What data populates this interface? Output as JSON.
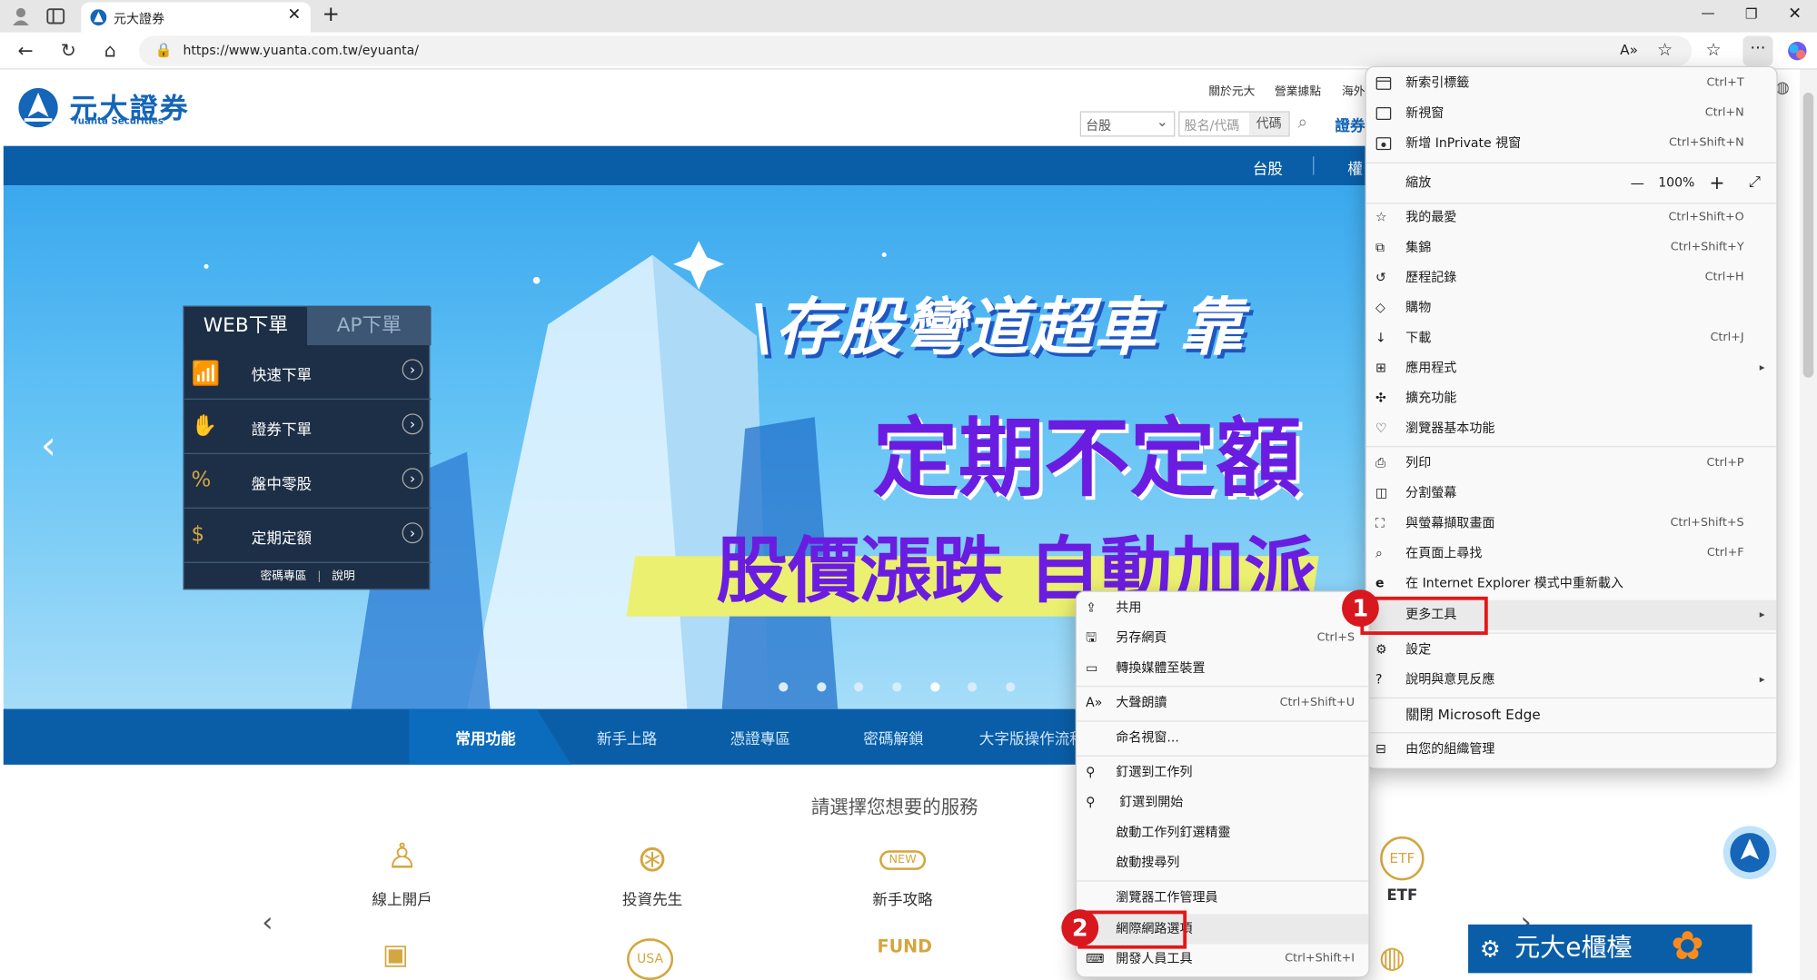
{
  "browser": {
    "tab_title": "元大證券",
    "url": "https://www.yuanta.com.tw/eyuanta/"
  },
  "site": {
    "logo_cn": "元大證券",
    "logo_en": "Yuanta Securities",
    "toplinks": [
      "關於元大",
      "營業據點",
      "海外"
    ],
    "market_select": "台股",
    "stock_placeholder": "股名/代碼",
    "code_label": "代碼",
    "nav_partial": "證券",
    "bluebar_links": [
      "台股",
      "權"
    ],
    "banner": {
      "headline1": "\\存股彎道超車 靠",
      "headline2": "定期不定額",
      "headline3": "股價漲跌 自動加派"
    },
    "panel": {
      "tab_active": "WEB下單",
      "tab_inactive": "AP下單",
      "rows": [
        "快速下單",
        "證券下單",
        "盤中零股",
        "定期定額"
      ],
      "footer_a": "密碼專區",
      "footer_b": "說明"
    },
    "navtabs": [
      "常用功能",
      "新手上路",
      "憑證專區",
      "密碼解鎖",
      "大字版操作流程"
    ],
    "service_title": "請選擇您想要的服務",
    "cards": [
      "線上開戶",
      "投資先生",
      "新手攻略",
      "ETF"
    ],
    "card_icon_texts": [
      "NEW",
      "ETF",
      "FUND",
      "USA"
    ],
    "ad_text": "元大e櫃檯"
  },
  "edge_menu": {
    "items": [
      {
        "label": "新索引標籤",
        "shortcut": "Ctrl+T",
        "icon": "new-tab-icon"
      },
      {
        "label": "新視窗",
        "shortcut": "Ctrl+N",
        "icon": "new-window-icon"
      },
      {
        "label": "新增 InPrivate 視窗",
        "shortcut": "Ctrl+Shift+N",
        "icon": "inprivate-icon"
      },
      {
        "label": "我的最愛",
        "shortcut": "Ctrl+Shift+O",
        "icon": "favorites-icon"
      },
      {
        "label": "集錦",
        "shortcut": "Ctrl+Shift+Y",
        "icon": "collections-icon"
      },
      {
        "label": "歷程記錄",
        "shortcut": "Ctrl+H",
        "icon": "history-icon"
      },
      {
        "label": "購物",
        "shortcut": "",
        "icon": "shopping-icon"
      },
      {
        "label": "下載",
        "shortcut": "Ctrl+J",
        "icon": "download-icon"
      },
      {
        "label": "應用程式",
        "shortcut": "",
        "icon": "apps-icon"
      },
      {
        "label": "擴充功能",
        "shortcut": "",
        "icon": "extensions-icon"
      },
      {
        "label": "瀏覽器基本功能",
        "shortcut": "",
        "icon": "browser-essentials-icon"
      },
      {
        "label": "列印",
        "shortcut": "Ctrl+P",
        "icon": "print-icon"
      },
      {
        "label": "分割螢幕",
        "shortcut": "",
        "icon": "split-screen-icon"
      },
      {
        "label": "與螢幕擷取畫面",
        "shortcut": "Ctrl+Shift+S",
        "icon": "screenshot-icon"
      },
      {
        "label": "在頁面上尋找",
        "shortcut": "Ctrl+F",
        "icon": "find-icon"
      },
      {
        "label": "在 Internet Explorer 模式中重新載入",
        "shortcut": "",
        "icon": "ie-mode-icon"
      },
      {
        "label": "更多工具",
        "shortcut": "",
        "icon": "more-tools-icon"
      },
      {
        "label": "設定",
        "shortcut": "",
        "icon": "settings-icon"
      },
      {
        "label": "說明與意見反應",
        "shortcut": "",
        "icon": "help-icon"
      },
      {
        "label": "關閉 Microsoft Edge",
        "shortcut": "",
        "icon": "close-edge-icon"
      },
      {
        "label": "由您的組織管理",
        "shortcut": "",
        "icon": "managed-icon"
      }
    ],
    "zoom_label": "縮放",
    "zoom_value": "100%",
    "zoom_minus": "—",
    "zoom_plus": "+"
  },
  "submenu": {
    "items": [
      {
        "label": "共用",
        "shortcut": "",
        "icon": "share-icon"
      },
      {
        "label": "另存網頁",
        "shortcut": "Ctrl+S",
        "icon": "save-page-icon"
      },
      {
        "label": "轉換媒體至裝置",
        "shortcut": "",
        "icon": "cast-icon"
      },
      {
        "label": "大聲朗讀",
        "shortcut": "Ctrl+Shift+U",
        "icon": "read-aloud-icon"
      },
      {
        "label": "命名視窗...",
        "shortcut": "",
        "icon": ""
      },
      {
        "label": "釘選到工作列",
        "shortcut": "",
        "icon": "pin-icon"
      },
      {
        "label": "釘選到開始",
        "shortcut": "",
        "icon": "pin-icon"
      },
      {
        "label": "啟動工作列釘選精靈",
        "shortcut": "",
        "icon": ""
      },
      {
        "label": "啟動搜尋列",
        "shortcut": "",
        "icon": ""
      },
      {
        "label": "瀏覽器工作管理員",
        "shortcut": "",
        "icon": ""
      },
      {
        "label": "網際網路選項",
        "shortcut": "",
        "icon": ""
      },
      {
        "label": "開發人員工具",
        "shortcut": "Ctrl+Shift+I",
        "icon": "devtools-icon"
      }
    ]
  },
  "annotations": {
    "step1": "1",
    "step2": "2"
  },
  "colors": {
    "brand_blue": "#0a5ea8",
    "highlight_red": "#e31818",
    "banner_purple": "#6a1de0"
  }
}
